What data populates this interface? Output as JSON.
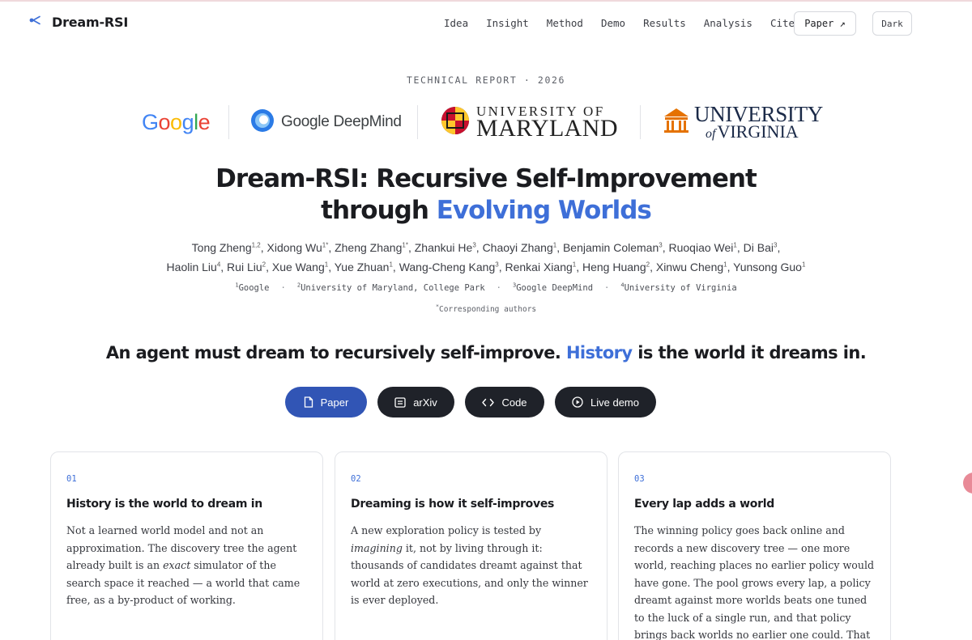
{
  "nav": {
    "brand": "Dream-RSI",
    "links": [
      "Idea",
      "Insight",
      "Method",
      "Demo",
      "Results",
      "Analysis",
      "Cite"
    ],
    "paper_button": "Paper ↗",
    "dark_button": "Dark"
  },
  "hero": {
    "eyebrow": "TECHNICAL REPORT · 2026",
    "logos": {
      "google": "Google",
      "deepmind": "Google DeepMind",
      "umd_top": "UNIVERSITY OF",
      "umd_bottom": "MARYLAND",
      "uva_top": "UNIVERSITY",
      "uva_of": "of",
      "uva_bottom": "VIRGINIA"
    },
    "title_line1": "Dream-RSI: Recursive Self-Improvement",
    "title_line2_prefix": "through ",
    "title_line2_accent": "Evolving Worlds",
    "authors": [
      {
        "name": "Tong Zheng",
        "sup": "1,2"
      },
      {
        "name": "Xidong Wu",
        "sup": "1*"
      },
      {
        "name": "Zheng Zhang",
        "sup": "1*"
      },
      {
        "name": "Zhankui He",
        "sup": "3"
      },
      {
        "name": "Chaoyi Zhang",
        "sup": "1"
      },
      {
        "name": "Benjamin Coleman",
        "sup": "3"
      },
      {
        "name": "Ruoqiao Wei",
        "sup": "1"
      },
      {
        "name": "Di Bai",
        "sup": "3"
      },
      {
        "name": "Haolin Liu",
        "sup": "4"
      },
      {
        "name": "Rui Liu",
        "sup": "2"
      },
      {
        "name": "Xue Wang",
        "sup": "1"
      },
      {
        "name": "Yue Zhuan",
        "sup": "1"
      },
      {
        "name": "Wang-Cheng Kang",
        "sup": "3"
      },
      {
        "name": "Renkai Xiang",
        "sup": "1"
      },
      {
        "name": "Heng Huang",
        "sup": "2"
      },
      {
        "name": "Xinwu Cheng",
        "sup": "1"
      },
      {
        "name": "Yunsong Guo",
        "sup": "1"
      }
    ],
    "affiliations": [
      {
        "sup": "1",
        "name": "Google"
      },
      {
        "sup": "2",
        "name": "University of Maryland, College Park"
      },
      {
        "sup": "3",
        "name": "Google DeepMind"
      },
      {
        "sup": "4",
        "name": "University of Virginia"
      }
    ],
    "corresponding_sup": "*",
    "corresponding": "Corresponding authors",
    "tagline_prefix": "An agent must dream to recursively self-improve. ",
    "tagline_accent": "History",
    "tagline_suffix": " is the world it dreams in."
  },
  "actions": {
    "paper": "Paper",
    "arxiv": "arXiv",
    "code": "Code",
    "demo": "Live demo"
  },
  "cards": [
    {
      "num": "01",
      "title": "History is the world to dream in",
      "body_html": "Not a learned world model and not an approximation. The discovery tree the agent already built is an <i>exact</i> simulator of the search space it reached — a world that came free, as a by-product of working."
    },
    {
      "num": "02",
      "title": "Dreaming is how it self-improves",
      "body_html": "A new exploration policy is tested by <i>imagining</i> it, not by living through it: thousands of candidates dreamt against that world at zero executions, and only the winner is ever deployed."
    },
    {
      "num": "03",
      "title": "Every lap adds a world",
      "body_html": "The winning policy goes back online and records a new discovery tree — one more world, reaching places no earlier policy would have gone. The pool grows every lap, a policy dreamt against more worlds beats one tuned to the luck of a single run, and that policy brings back worlds no earlier one could. That is"
    }
  ],
  "colors": {
    "accent": "#3e6fd8",
    "primary_button": "#3155b5",
    "dark_button": "#1f2229"
  }
}
